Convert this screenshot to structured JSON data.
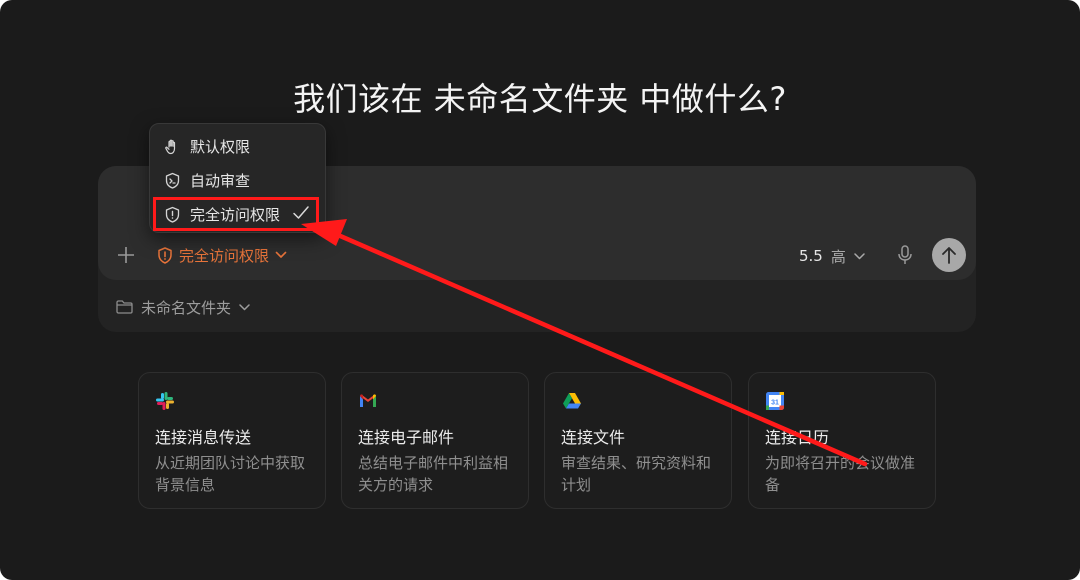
{
  "headline": "我们该在 未命名文件夹 中做什么?",
  "permission_menu": {
    "items": [
      {
        "label": "默认权限",
        "icon": "hand-icon"
      },
      {
        "label": "自动审查",
        "icon": "terminal-shield-icon"
      },
      {
        "label": "完全访问权限",
        "icon": "warning-shield-icon",
        "selected": true
      }
    ]
  },
  "composer": {
    "permission_label": "完全访问权限",
    "model_version": "5.5",
    "effort_label": "高",
    "folder_label": "未命名文件夹"
  },
  "cards": [
    {
      "icon": "slack-icon",
      "title": "连接消息传送",
      "description": "从近期团队讨论中获取背景信息"
    },
    {
      "icon": "gmail-icon",
      "title": "连接电子邮件",
      "description": "总结电子邮件中利益相关方的请求"
    },
    {
      "icon": "google-drive-icon",
      "title": "连接文件",
      "description": "审查结果、研究资料和计划"
    },
    {
      "icon": "google-calendar-icon",
      "title": "连接日历",
      "description": "为即将召开的会议做准备",
      "calendar_day": "31"
    }
  ],
  "colors": {
    "background": "#1b1b1b",
    "accent_orange": "#e8743a",
    "annotation_red": "#ff1a1a"
  }
}
